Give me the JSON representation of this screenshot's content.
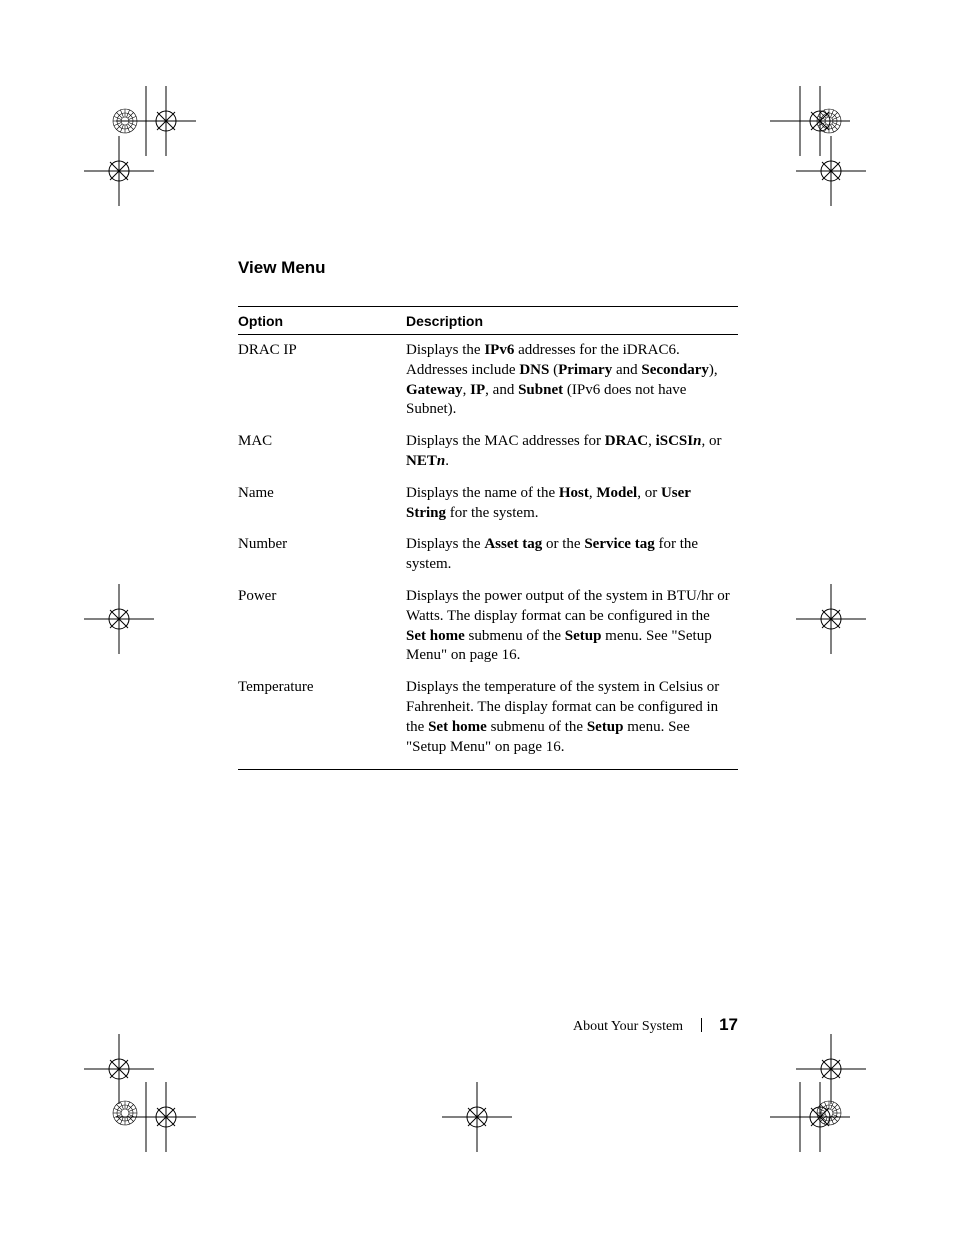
{
  "section_title": "View Menu",
  "table": {
    "headers": {
      "option": "Option",
      "description": "Description"
    },
    "rows": [
      {
        "option": "DRAC IP",
        "parts": [
          {
            "t": "Displays the "
          },
          {
            "b": "IPv6"
          },
          {
            "t": " addresses for the iDRAC6. Addresses include "
          },
          {
            "b": "DNS"
          },
          {
            "t": " ("
          },
          {
            "b": "Primary"
          },
          {
            "t": " and "
          },
          {
            "b": "Secondary"
          },
          {
            "t": "), "
          },
          {
            "b": "Gateway"
          },
          {
            "t": ", "
          },
          {
            "b": "IP"
          },
          {
            "t": ", and "
          },
          {
            "b": "Subnet"
          },
          {
            "t": " (IPv6 does not have Subnet)."
          }
        ]
      },
      {
        "option": "MAC",
        "parts": [
          {
            "t": "Displays the MAC addresses for "
          },
          {
            "b": "DRAC"
          },
          {
            "t": ", "
          },
          {
            "b": "iSCSI"
          },
          {
            "bi": "n"
          },
          {
            "t": ", or "
          },
          {
            "b": "NET"
          },
          {
            "bi": "n"
          },
          {
            "t": "."
          }
        ]
      },
      {
        "option": "Name",
        "parts": [
          {
            "t": "Displays the name of the "
          },
          {
            "b": "Host"
          },
          {
            "t": ", "
          },
          {
            "b": "Model"
          },
          {
            "t": ", or "
          },
          {
            "b": "User String"
          },
          {
            "t": " for the system."
          }
        ]
      },
      {
        "option": "Number",
        "parts": [
          {
            "t": "Displays the "
          },
          {
            "b": "Asset tag"
          },
          {
            "t": " or the "
          },
          {
            "b": "Service tag"
          },
          {
            "t": " for the system."
          }
        ]
      },
      {
        "option": "Power",
        "parts": [
          {
            "t": "Displays the power output of the system in BTU/hr or Watts. The display format can be configured in the "
          },
          {
            "b": "Set home"
          },
          {
            "t": " submenu of the "
          },
          {
            "b": "Setup"
          },
          {
            "t": " menu. See \"Setup Menu\" on page 16."
          }
        ]
      },
      {
        "option": "Temperature",
        "parts": [
          {
            "t": "Displays the temperature of the system in Celsius or Fahrenheit. The display format can be configured in the "
          },
          {
            "b": "Set home"
          },
          {
            "t": " submenu of the "
          },
          {
            "b": "Setup"
          },
          {
            "t": " menu. See \"Setup Menu\" on page 16."
          }
        ]
      }
    ]
  },
  "footer": {
    "label": "About Your System",
    "page_number": "17"
  }
}
